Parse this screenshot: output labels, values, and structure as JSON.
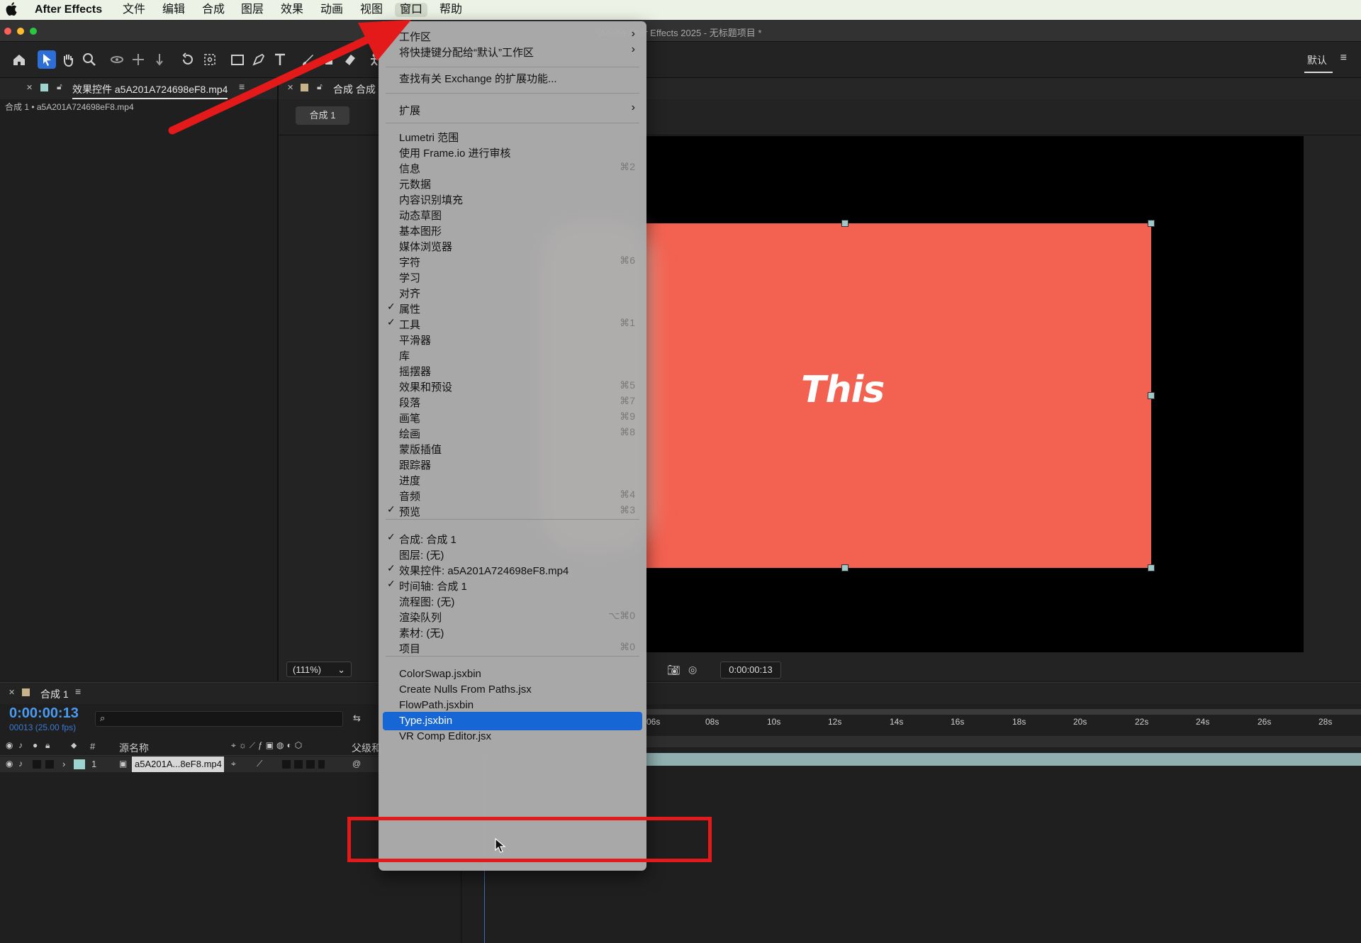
{
  "menubar": {
    "items": [
      "After Effects",
      "文件",
      "编辑",
      "合成",
      "图层",
      "效果",
      "动画",
      "视图",
      "窗口",
      "帮助"
    ]
  },
  "window": {
    "title": "Adobe After Effects 2025 - 无标题项目 *"
  },
  "workspace": {
    "label": "默认"
  },
  "effect_panel": {
    "tab_label": "效果控件 a5A201A724698eF8.mp4",
    "breadcrumb": "合成 1 • a5A201A724698eF8.mp4"
  },
  "comp_panel": {
    "tab_label": "合成 合成",
    "comp_button": "合成 1",
    "zoom": "(111%)",
    "timecode": "0:00:00:13"
  },
  "composition": {
    "text": "This"
  },
  "timeline": {
    "tab_label": "合成 1",
    "current_time": "0:00:00:13",
    "frame_info": "00013 (25.00 fps)",
    "col_num": "#",
    "col_source": "源名称",
    "col_parent": "父级和",
    "layer": {
      "index": "1",
      "name": "a5A201A...8eF8.mp4"
    },
    "ruler": [
      "06s",
      "08s",
      "10s",
      "12s",
      "14s",
      "16s",
      "18s",
      "20s",
      "22s",
      "24s",
      "26s",
      "28s"
    ]
  },
  "window_menu": {
    "items": [
      {
        "label": "工作区",
        "submenu": true
      },
      {
        "label": "将快捷键分配给“默认”工作区",
        "submenu": true
      },
      {
        "label": "查找有关 Exchange 的扩展功能..."
      },
      {
        "label": "扩展",
        "submenu": true
      },
      {
        "label": "Lumetri 范围"
      },
      {
        "label": "使用 Frame.io 进行审核"
      },
      {
        "label": "信息",
        "shortcut": "⌘2"
      },
      {
        "label": "元数据"
      },
      {
        "label": "内容识别填充"
      },
      {
        "label": "动态草图"
      },
      {
        "label": "基本图形"
      },
      {
        "label": "媒体浏览器"
      },
      {
        "label": "字符",
        "shortcut": "⌘6"
      },
      {
        "label": "学习"
      },
      {
        "label": "对齐"
      },
      {
        "label": "属性",
        "checked": true
      },
      {
        "label": "工具",
        "checked": true,
        "shortcut": "⌘1"
      },
      {
        "label": "平滑器"
      },
      {
        "label": "库"
      },
      {
        "label": "摇摆器"
      },
      {
        "label": "效果和预设",
        "shortcut": "⌘5"
      },
      {
        "label": "段落",
        "shortcut": "⌘7"
      },
      {
        "label": "画笔",
        "shortcut": "⌘9"
      },
      {
        "label": "绘画",
        "shortcut": "⌘8"
      },
      {
        "label": "蒙版插值"
      },
      {
        "label": "跟踪器"
      },
      {
        "label": "进度"
      },
      {
        "label": "音频",
        "shortcut": "⌘4"
      },
      {
        "label": "预览",
        "checked": true,
        "shortcut": "⌘3"
      },
      {
        "label": "合成: 合成 1",
        "checked": true
      },
      {
        "label": "图层: (无)"
      },
      {
        "label": "效果控件: a5A201A724698eF8.mp4",
        "checked": true
      },
      {
        "label": "时间轴: 合成 1",
        "checked": true
      },
      {
        "label": "流程图: (无)"
      },
      {
        "label": "渲染队列",
        "shortcut": "⌥⌘0"
      },
      {
        "label": "素材: (无)"
      },
      {
        "label": "项目",
        "shortcut": "⌘0"
      },
      {
        "label": "ColorSwap.jsxbin"
      },
      {
        "label": "Create Nulls From Paths.jsx"
      },
      {
        "label": "FlowPath.jsxbin"
      },
      {
        "label": "Type.jsxbin",
        "highlighted": true
      },
      {
        "label": "VR Comp Editor.jsx"
      }
    ],
    "check_glyph": "✓",
    "arrow_glyph": "›"
  },
  "colors": {
    "accent": "#1766d6",
    "annotation_red": "#e41919",
    "comp_background": "#f36150"
  }
}
